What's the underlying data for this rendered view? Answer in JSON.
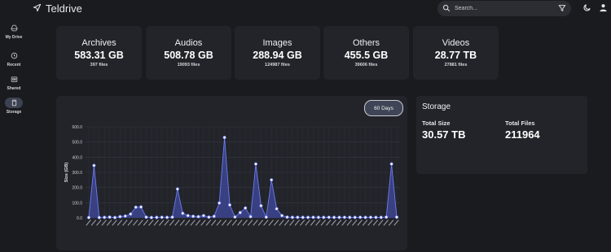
{
  "app": {
    "title": "Teldrive"
  },
  "search": {
    "placeholder": "Search..."
  },
  "sidebar": {
    "items": [
      {
        "label": "My Drive",
        "icon": "drive-icon"
      },
      {
        "label": "Recent",
        "icon": "clock-icon"
      },
      {
        "label": "Shared",
        "icon": "shared-icon"
      },
      {
        "label": "Storage",
        "icon": "storage-icon"
      }
    ]
  },
  "categories": [
    {
      "name": "Archives",
      "size": "583.31 GB",
      "files": "397 files"
    },
    {
      "name": "Audios",
      "size": "508.78 GB",
      "files": "19093 files"
    },
    {
      "name": "Images",
      "size": "288.94 GB",
      "files": "124987 files"
    },
    {
      "name": "Others",
      "size": "455.5 GB",
      "files": "39606 files"
    },
    {
      "name": "Videos",
      "size": "28.77 TB",
      "files": "27881 files"
    }
  ],
  "range_button": {
    "label": "60 Days"
  },
  "storage": {
    "title": "Storage",
    "total_size_label": "Total Size",
    "total_size": "30.57 TB",
    "total_files_label": "Total Files",
    "total_files": "211964"
  },
  "colors": {
    "accent": "#6c7cf2",
    "fill": "#3d4590",
    "background": "#191b1f",
    "card": "#22242a"
  },
  "chart_data": {
    "type": "area",
    "ylabel": "Size (GB)",
    "xlabel": "",
    "ylim": [
      0,
      600
    ],
    "yticks": [
      "600.0",
      "500.0",
      "400.0",
      "300.0",
      "200.0",
      "100.0",
      "0.0"
    ],
    "grid": true,
    "legend": "none",
    "values": [
      2,
      345,
      2,
      3,
      5,
      2,
      8,
      12,
      25,
      70,
      72,
      5,
      2,
      3,
      4,
      3,
      5,
      190,
      30,
      15,
      10,
      8,
      15,
      5,
      10,
      98,
      530,
      85,
      6,
      35,
      65,
      8,
      355,
      80,
      5,
      250,
      60,
      15,
      5,
      3,
      4,
      3,
      3,
      4,
      3,
      3,
      4,
      3,
      3,
      4,
      3,
      3,
      4,
      3,
      4,
      3,
      3,
      5,
      355,
      5
    ]
  }
}
